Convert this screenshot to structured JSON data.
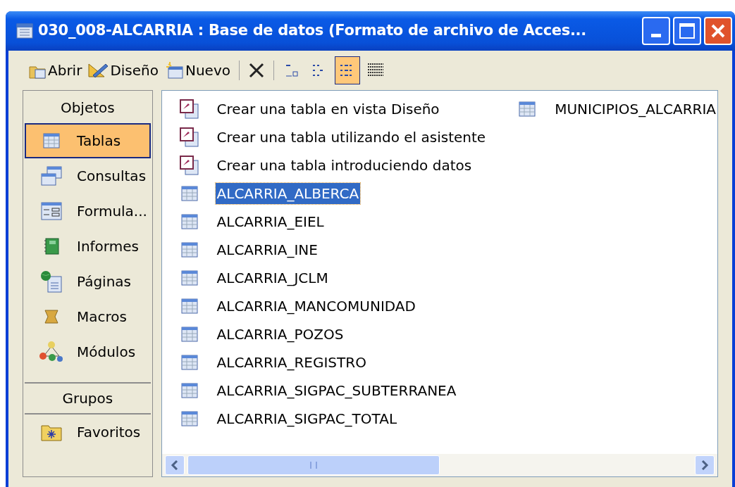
{
  "window": {
    "title": "030_008-ALCARRIA : Base de datos (Formato de archivo de Acces..."
  },
  "toolbar": {
    "buttons": [
      {
        "kind": "open",
        "label": "Abrir"
      },
      {
        "kind": "design",
        "label": "Diseño"
      },
      {
        "kind": "new",
        "label": "Nuevo"
      },
      {
        "kind": "delete"
      },
      {
        "kind": "large-icons",
        "selected": false
      },
      {
        "kind": "small-icons",
        "selected": false
      },
      {
        "kind": "list",
        "selected": true
      },
      {
        "kind": "details",
        "selected": false
      }
    ]
  },
  "sidebar": {
    "sections": [
      {
        "title": "Objetos",
        "items": [
          {
            "kind": "tables",
            "label": "Tablas",
            "selected": true
          },
          {
            "kind": "queries",
            "label": "Consultas",
            "selected": false
          },
          {
            "kind": "forms",
            "label": "Formula...",
            "selected": false
          },
          {
            "kind": "reports",
            "label": "Informes",
            "selected": false
          },
          {
            "kind": "pages",
            "label": "Páginas",
            "selected": false
          },
          {
            "kind": "macros",
            "label": "Macros",
            "selected": false
          },
          {
            "kind": "modules",
            "label": "Módulos",
            "selected": false
          }
        ]
      },
      {
        "title": "Grupos",
        "items": [
          {
            "kind": "favorites",
            "label": "Favoritos",
            "selected": false
          }
        ]
      }
    ]
  },
  "list": {
    "items": [
      {
        "kind": "shortcut",
        "label": "Crear una tabla en vista Diseño",
        "selected": false
      },
      {
        "kind": "shortcut",
        "label": "Crear una tabla utilizando el asistente",
        "selected": false
      },
      {
        "kind": "shortcut",
        "label": "Crear una tabla introduciendo datos",
        "selected": false
      },
      {
        "kind": "table",
        "label": "ALCARRIA_ALBERCA",
        "selected": true
      },
      {
        "kind": "table",
        "label": "ALCARRIA_EIEL",
        "selected": false
      },
      {
        "kind": "table",
        "label": "ALCARRIA_INE",
        "selected": false
      },
      {
        "kind": "table",
        "label": "ALCARRIA_JCLM",
        "selected": false
      },
      {
        "kind": "table",
        "label": "ALCARRIA_MANCOMUNIDAD",
        "selected": false
      },
      {
        "kind": "table",
        "label": "ALCARRIA_POZOS",
        "selected": false
      },
      {
        "kind": "table",
        "label": "ALCARRIA_REGISTRO",
        "selected": false
      },
      {
        "kind": "table",
        "label": "ALCARRIA_SIGPAC_SUBTERRANEA",
        "selected": false
      },
      {
        "kind": "table",
        "label": "ALCARRIA_SIGPAC_TOTAL",
        "selected": false
      },
      {
        "kind": "table",
        "label": "MUNICIPIOS_ALCARRIA",
        "selected": false
      }
    ]
  }
}
